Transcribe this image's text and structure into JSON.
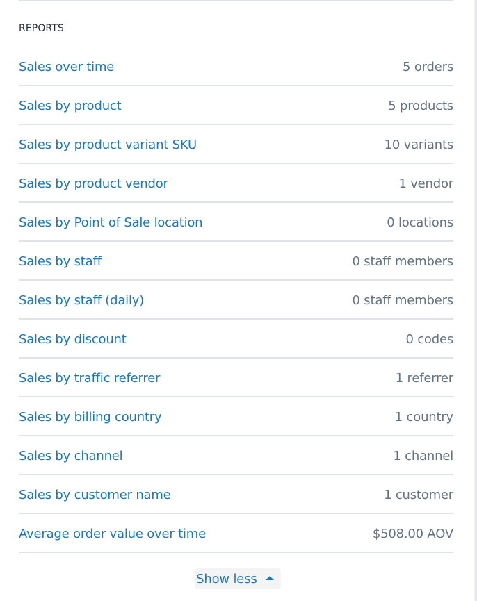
{
  "section": {
    "title": "REPORTS"
  },
  "reports": [
    {
      "label": "Sales over time",
      "value": "5 orders"
    },
    {
      "label": "Sales by product",
      "value": "5 products"
    },
    {
      "label": "Sales by product variant SKU",
      "value": "10 variants"
    },
    {
      "label": "Sales by product vendor",
      "value": "1 vendor"
    },
    {
      "label": "Sales by Point of Sale location",
      "value": "0 locations"
    },
    {
      "label": "Sales by staff",
      "value": "0 staff members"
    },
    {
      "label": "Sales by staff (daily)",
      "value": "0 staff members"
    },
    {
      "label": "Sales by discount",
      "value": "0 codes"
    },
    {
      "label": "Sales by traffic referrer",
      "value": "1 referrer"
    },
    {
      "label": "Sales by billing country",
      "value": "1 country"
    },
    {
      "label": "Sales by channel",
      "value": "1 channel"
    },
    {
      "label": "Sales by customer name",
      "value": "1 customer"
    },
    {
      "label": "Average order value over time",
      "value": "$508.00 AOV"
    }
  ],
  "toggle": {
    "label": "Show less",
    "icon": "caret-up-icon"
  },
  "colors": {
    "link": "#1c77c3",
    "value_text": "#637381",
    "heading": "#212b36",
    "divider": "#dfe3e8"
  }
}
